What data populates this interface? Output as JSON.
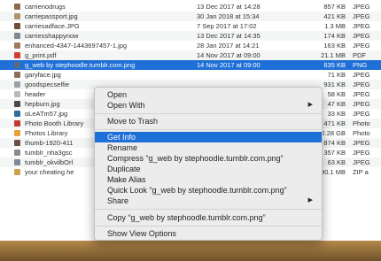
{
  "files": [
    {
      "name": "carrienodrugs",
      "date": "13 Dec 2017 at 14:28",
      "size": "857 KB",
      "kind": "JPEG",
      "icon_color": "#8a6a4a"
    },
    {
      "name": "carriepassport.jpg",
      "date": "30 Jan 2018 at 15:34",
      "size": "421 KB",
      "kind": "JPEG",
      "icon_color": "#b0946e"
    },
    {
      "name": "carriesadface.JPG",
      "date": "7 Sep 2017 at 17:02",
      "size": "1.3 MB",
      "kind": "JPEG",
      "icon_color": "#6d4d3a"
    },
    {
      "name": "carriesshappynow",
      "date": "13 Dec 2017 at 14:35",
      "size": "174 KB",
      "kind": "JPEG",
      "icon_color": "#7f8a90"
    },
    {
      "name": "enhanced-4347-1443697457-1.jpg",
      "date": "28 Jan 2017 at 14:21",
      "size": "163 KB",
      "kind": "JPEG",
      "icon_color": "#a07a5a"
    },
    {
      "name": "g_print.pdf",
      "date": "14 Nov 2017 at 09:00",
      "size": "21.1 MB",
      "kind": "PDF",
      "icon_color": "#d33b33"
    },
    {
      "name": "g_web by stephoodle.tumblr.com.png",
      "date": "14 Nov 2017 at 09:00",
      "size": "635 KB",
      "kind": "PNG",
      "icon_color": "#5b6b7b"
    },
    {
      "name": "garyface.jpg",
      "date": "",
      "size": "71 KB",
      "kind": "JPEG",
      "icon_color": "#8f6e55"
    },
    {
      "name": "goodspecselfie",
      "date": "",
      "size": "931 KB",
      "kind": "JPEG",
      "icon_color": "#9aa0a6"
    },
    {
      "name": "header",
      "date": "",
      "size": "58 KB",
      "kind": "JPEG",
      "icon_color": "#b8b8b8"
    },
    {
      "name": "hepburn.jpg",
      "date": "",
      "size": "47 KB",
      "kind": "JPEG",
      "icon_color": "#4a4a4a"
    },
    {
      "name": "oLeATm57.jpg",
      "date": "",
      "size": "33 KB",
      "kind": "JPEG",
      "icon_color": "#2f6fa0"
    },
    {
      "name": "Photo Booth Library",
      "date": "",
      "size": "471 KB",
      "kind": "Photo",
      "icon_color": "#c23a2f"
    },
    {
      "name": "Photos Library",
      "date": "",
      "size": "72.28 GB",
      "kind": "Photo",
      "icon_color": "#e8a23a"
    },
    {
      "name": "thumb-1920-411",
      "date": "",
      "size": "874 KB",
      "kind": "JPEG",
      "icon_color": "#6a5040"
    },
    {
      "name": "tumblr_nha3gsc",
      "date": "",
      "size": "357 KB",
      "kind": "JPEG",
      "icon_color": "#8a8a8a"
    },
    {
      "name": "tumblr_okvilbOrl",
      "date": "",
      "size": "63 KB",
      "kind": "JPEG",
      "icon_color": "#7a8a9a"
    },
    {
      "name": "your cheating he",
      "date": "",
      "size": "90.1 MB",
      "kind": "ZIP a",
      "icon_color": "#caa44a"
    }
  ],
  "context_menu": {
    "open": "Open",
    "open_with": "Open With",
    "move_to_trash": "Move to Trash",
    "get_info": "Get Info",
    "rename": "Rename",
    "compress": "Compress “g_web by stephoodle.tumblr.com.png”",
    "duplicate": "Duplicate",
    "make_alias": "Make Alias",
    "quick_look": "Quick Look “g_web by stephoodle.tumblr.com.png”",
    "share": "Share",
    "copy": "Copy “g_web by stephoodle.tumblr.com.png”",
    "show_view_options": "Show View Options",
    "submenu_arrow": "▶"
  },
  "colors": {
    "selection": "#1f6fd8",
    "menu_bg": "#ececec"
  }
}
